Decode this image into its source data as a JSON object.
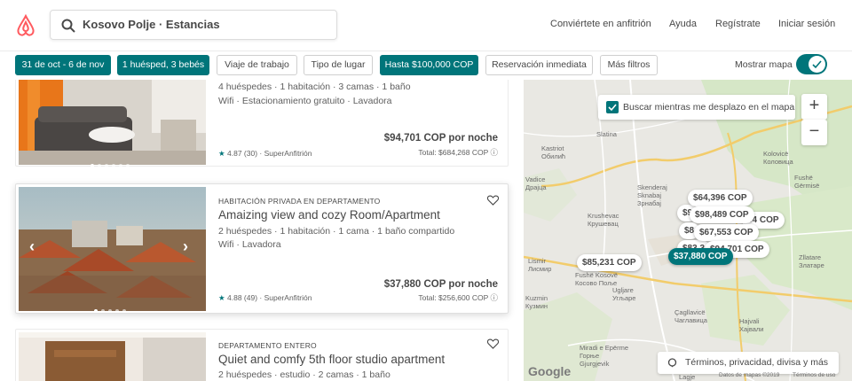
{
  "header": {
    "search_text": "Kosovo Polje · Estancias",
    "nav": [
      "Conviértete en anfitrión",
      "Ayuda",
      "Regístrate",
      "Iniciar sesión"
    ]
  },
  "filters": {
    "chips": [
      "31 de oct - 6 de nov",
      "1 huésped, 3 bebés",
      "Viaje de trabajo",
      "Tipo de lugar",
      "Hasta $100,000 COP",
      "Reservación inmediata",
      "Más filtros"
    ],
    "map_toggle_label": "Mostrar mapa"
  },
  "listings": [
    {
      "kind": "",
      "title": "",
      "details": "4 huéspedes · 1 habitación · 3 camas · 1 baño",
      "amenities": "Wifi · Estacionamiento gratuito · Lavadora",
      "price": "$94,701 COP por noche",
      "total": "Total: $684,268 COP",
      "rating": "4.87",
      "reviews": "(30)",
      "badge": "· SuperAnfitrión"
    },
    {
      "kind": "HABITACIÓN PRIVADA EN DEPARTAMENTO",
      "title": "Amaizing view and cozy Room/Apartment",
      "details": "2 huéspedes · 1 habitación · 1 cama · 1 baño compartido",
      "amenities": "Wifi · Lavadora",
      "price": "$37,880 COP por noche",
      "total": "Total: $256,600 COP",
      "rating": "4.88",
      "reviews": "(49)",
      "badge": "· SuperAnfitrión"
    },
    {
      "kind": "DEPARTAMENTO ENTERO",
      "title": "Quiet and comfy 5th floor studio apartment",
      "details": "2 huéspedes · estudio · 2 camas · 1 baño"
    }
  ],
  "map": {
    "search_on_move": "Buscar mientras me desplazo en el mapa",
    "zoom_in": "+",
    "zoom_out": "−",
    "pins": [
      "$64,396 COP",
      "$98,489 COP",
      "$67,553 COP",
      "$94,701 COP",
      "$85,231 COP",
      "$37,880 COP",
      "$9",
      "84 COP",
      "$8",
      "$83,3"
    ],
    "towns": [
      "Kastriot",
      "Обилић",
      "Slatina",
      "Kolovicë",
      "Коловица",
      "Fushë",
      "Gërmisë",
      "Skenderaj",
      "Sknabaj",
      "Зрнабај",
      "Vadice",
      "Драјца",
      "Krushevac",
      "Крушевац",
      "Lismir",
      "Лисмир",
      "Fushë Kosovë",
      "Косово Поље",
      "Ugljare",
      "Угљаре",
      "Kuzmin",
      "Кузмин",
      "Çagllavicë",
      "Чаглавица",
      "Hajvali",
      "Хајвали",
      "Zllatare",
      "Златаре",
      "Miradi e Epërme",
      "Горње",
      "Gjurgjevik",
      "Lagje"
    ],
    "terms": "Términos, privacidad, divisa y más",
    "google": "Google",
    "attribution": "Datos de mapas ©2019",
    "terms_of_use": "Términos de uso"
  },
  "colors": {
    "accent": "#00757a",
    "brand": "#ff5a5f"
  }
}
